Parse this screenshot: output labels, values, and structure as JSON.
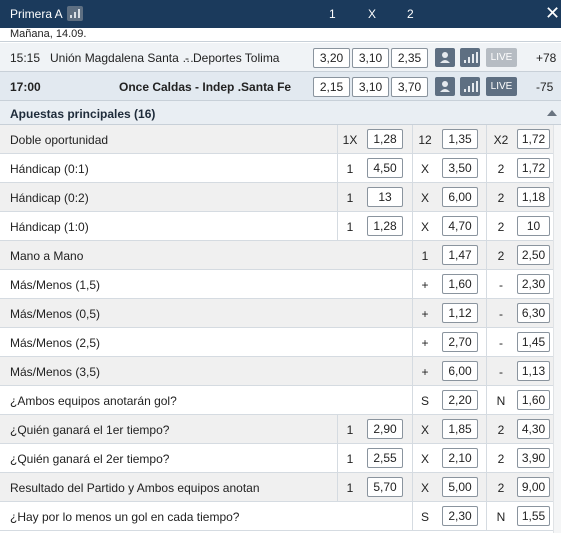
{
  "header": {
    "title": "Primera A",
    "cols": [
      "1",
      "X",
      "2"
    ],
    "stats_icon": "stats-icon",
    "close_icon": "close-icon"
  },
  "date": "Mañana, 14.09.",
  "matches": [
    {
      "time": "15:15",
      "home": "Unión Magdalena Santa …",
      "sep": "-",
      "away": "Deportes Tolima",
      "odds": [
        "3,20",
        "3,10",
        "2,35"
      ],
      "live": "LIVE",
      "more": "+78",
      "bold": false,
      "bg": "#f0f3f6",
      "live_color": "#b6bcc3"
    },
    {
      "time": "17:00",
      "home": "Once Caldas",
      "sep": "-",
      "away": "Indep .Santa Fe",
      "odds": [
        "2,15",
        "3,10",
        "3,70"
      ],
      "live": "LIVE",
      "more": "-75",
      "bold": true,
      "bg": "#e2e9f0",
      "live_color": "#5e6f82"
    }
  ],
  "section": {
    "title": "Apuestas principales (16)"
  },
  "markets": [
    {
      "label": "Doble oportunidad",
      "layout": "three",
      "shaded": true,
      "keys": [
        "1X",
        "12",
        "X2"
      ],
      "odds": [
        "1,28",
        "1,35",
        "1,72"
      ]
    },
    {
      "label": "Hándicap (0:1)",
      "layout": "three",
      "shaded": false,
      "keys": [
        "1",
        "X",
        "2"
      ],
      "odds": [
        "4,50",
        "3,50",
        "1,72"
      ]
    },
    {
      "label": "Hándicap (0:2)",
      "layout": "three",
      "shaded": true,
      "keys": [
        "1",
        "X",
        "2"
      ],
      "odds": [
        "13",
        "6,00",
        "1,18"
      ]
    },
    {
      "label": "Hándicap (1:0)",
      "layout": "three",
      "shaded": false,
      "keys": [
        "1",
        "X",
        "2"
      ],
      "odds": [
        "1,28",
        "4,70",
        "10"
      ]
    },
    {
      "label": "Mano a Mano",
      "layout": "two",
      "shaded": true,
      "keys": [
        "1",
        "2"
      ],
      "odds": [
        "1,47",
        "2,50"
      ]
    },
    {
      "label": "Más/Menos (1,5)",
      "layout": "two",
      "shaded": false,
      "keys": [
        "+",
        "-"
      ],
      "odds": [
        "1,60",
        "2,30"
      ]
    },
    {
      "label": "Más/Menos (0,5)",
      "layout": "two",
      "shaded": true,
      "keys": [
        "+",
        "-"
      ],
      "odds": [
        "1,12",
        "6,30"
      ]
    },
    {
      "label": "Más/Menos (2,5)",
      "layout": "two",
      "shaded": false,
      "keys": [
        "+",
        "-"
      ],
      "odds": [
        "2,70",
        "1,45"
      ]
    },
    {
      "label": "Más/Menos (3,5)",
      "layout": "two",
      "shaded": true,
      "keys": [
        "+",
        "-"
      ],
      "odds": [
        "6,00",
        "1,13"
      ]
    },
    {
      "label": "¿Ambos equipos anotarán gol?",
      "layout": "two",
      "shaded": false,
      "keys": [
        "S",
        "N"
      ],
      "odds": [
        "2,20",
        "1,60"
      ]
    },
    {
      "label": "¿Quién ganará el 1er tiempo?",
      "layout": "three",
      "shaded": true,
      "keys": [
        "1",
        "X",
        "2"
      ],
      "odds": [
        "2,90",
        "1,85",
        "4,30"
      ]
    },
    {
      "label": "¿Quién ganará el 2er tiempo?",
      "layout": "three",
      "shaded": false,
      "keys": [
        "1",
        "X",
        "2"
      ],
      "odds": [
        "2,55",
        "2,10",
        "3,90"
      ]
    },
    {
      "label": "Resultado del Partido y Ambos equipos anotan",
      "layout": "three",
      "shaded": true,
      "keys": [
        "1",
        "X",
        "2"
      ],
      "odds": [
        "5,70",
        "5,00",
        "9,00"
      ]
    },
    {
      "label": "¿Hay por lo menos un gol en cada tiempo?",
      "layout": "two",
      "shaded": false,
      "keys": [
        "S",
        "N"
      ],
      "odds": [
        "2,30",
        "1,55"
      ]
    }
  ],
  "colors": {
    "header_bg": "#1b3a5c",
    "row_shaded": "#f0f0f0",
    "section_bg": "#e9eef3"
  }
}
